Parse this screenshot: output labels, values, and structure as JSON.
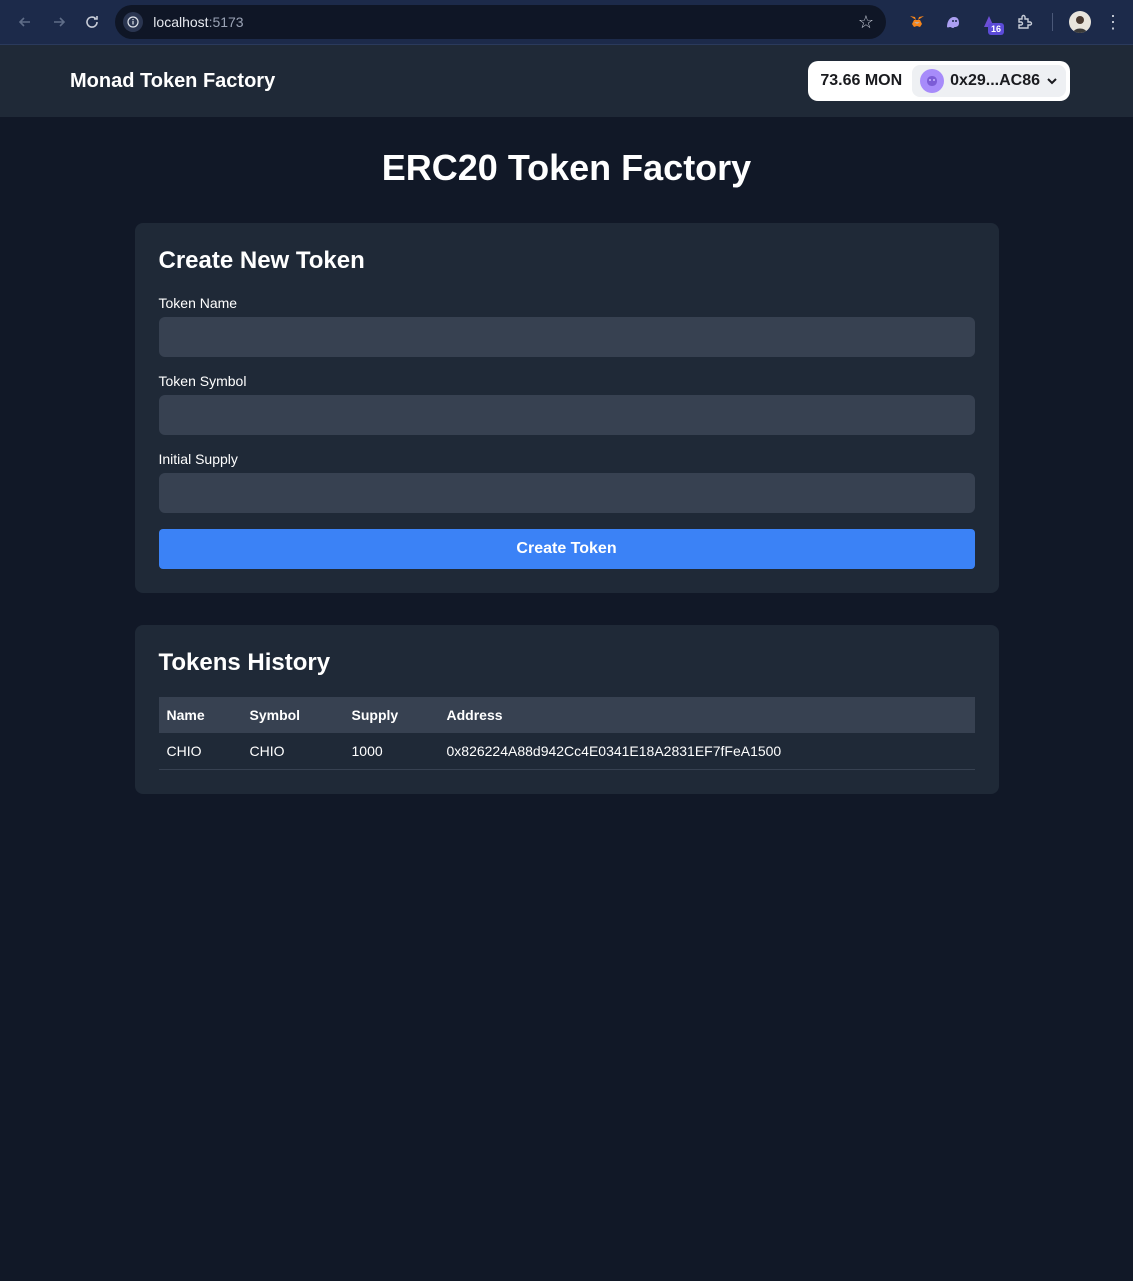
{
  "browser": {
    "url_host": "localhost",
    "url_port": ":5173",
    "extension_badge": "16"
  },
  "header": {
    "brand": "Monad Token Factory",
    "balance": "73.66 MON",
    "account": "0x29...AC86"
  },
  "page": {
    "title": "ERC20 Token Factory"
  },
  "create_form": {
    "title": "Create New Token",
    "fields": [
      {
        "label": "Token Name",
        "value": ""
      },
      {
        "label": "Token Symbol",
        "value": ""
      },
      {
        "label": "Initial Supply",
        "value": ""
      }
    ],
    "submit_label": "Create Token"
  },
  "history": {
    "title": "Tokens History",
    "columns": [
      "Name",
      "Symbol",
      "Supply",
      "Address"
    ],
    "rows": [
      [
        "CHIO",
        "CHIO",
        "1000",
        "0x826224A88d942Cc4E0341E18A2831EF7fFeA1500"
      ]
    ]
  },
  "colors": {
    "background": "#111827",
    "card": "#1f2937",
    "input": "#374151",
    "accent": "#3b82f6"
  }
}
